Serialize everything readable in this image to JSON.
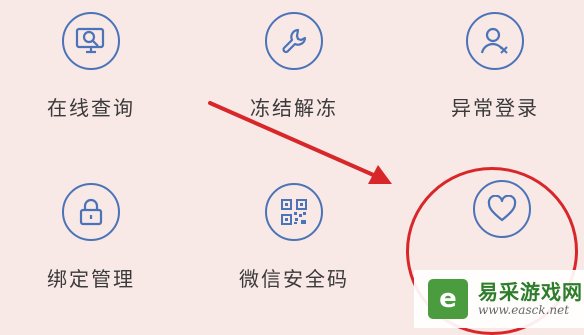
{
  "tiles": {
    "online_query": {
      "label": "在线查询",
      "icon": "monitor-search-icon"
    },
    "freeze_unfreeze": {
      "label": "冻结解冻",
      "icon": "wrench-icon"
    },
    "abnormal_login": {
      "label": "异常登录",
      "icon": "user-x-icon"
    },
    "binding_management": {
      "label": "绑定管理",
      "icon": "lock-icon"
    },
    "wechat_security_code": {
      "label": "微信安全码",
      "icon": "qr-code-icon"
    },
    "favorite": {
      "label": "",
      "icon": "heart-icon"
    }
  },
  "watermark": {
    "logo": "e",
    "name": "易采游戏网",
    "domain": "www.easck.net"
  },
  "colors": {
    "background": "#f8e8e6",
    "icon_blue": "#4b73b8",
    "highlight_red": "#d8272a",
    "brand_green": "#4b9b3f"
  }
}
